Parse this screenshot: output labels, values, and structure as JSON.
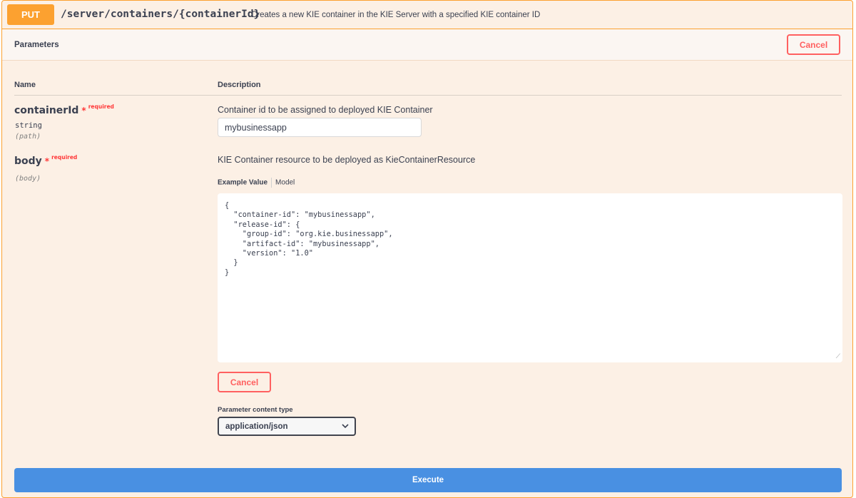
{
  "operation": {
    "method": "PUT",
    "path": "/server/containers/{containerId}",
    "summary": "Creates a new KIE container in the KIE Server with a specified KIE container ID"
  },
  "parameters": {
    "section_title": "Parameters",
    "cancel_label": "Cancel",
    "col_name": "Name",
    "col_description": "Description",
    "items": [
      {
        "name": "containerId",
        "required_mark": "*",
        "required_label": "required",
        "type": "string",
        "in": "(path)",
        "description": "Container id to be assigned to deployed KIE Container",
        "value": "mybusinessapp"
      },
      {
        "name": "body",
        "required_mark": "*",
        "required_label": "required",
        "in": "(body)",
        "description": "KIE Container resource to be deployed as KieContainerResource"
      }
    ]
  },
  "body_editor": {
    "tab_example": "Example Value",
    "tab_model": "Model",
    "value": "{\n  \"container-id\": \"mybusinessapp\",\n  \"release-id\": {\n    \"group-id\": \"org.kie.businessapp\",\n    \"artifact-id\": \"mybusinessapp\",\n    \"version\": \"1.0\"\n  }\n}",
    "cancel_label": "Cancel"
  },
  "content_type": {
    "label": "Parameter content type",
    "selected": "application/json"
  },
  "execute_label": "Execute",
  "colors": {
    "put_accent": "#fca130",
    "cancel_red": "#ff6060",
    "execute_blue": "#4990e2"
  }
}
